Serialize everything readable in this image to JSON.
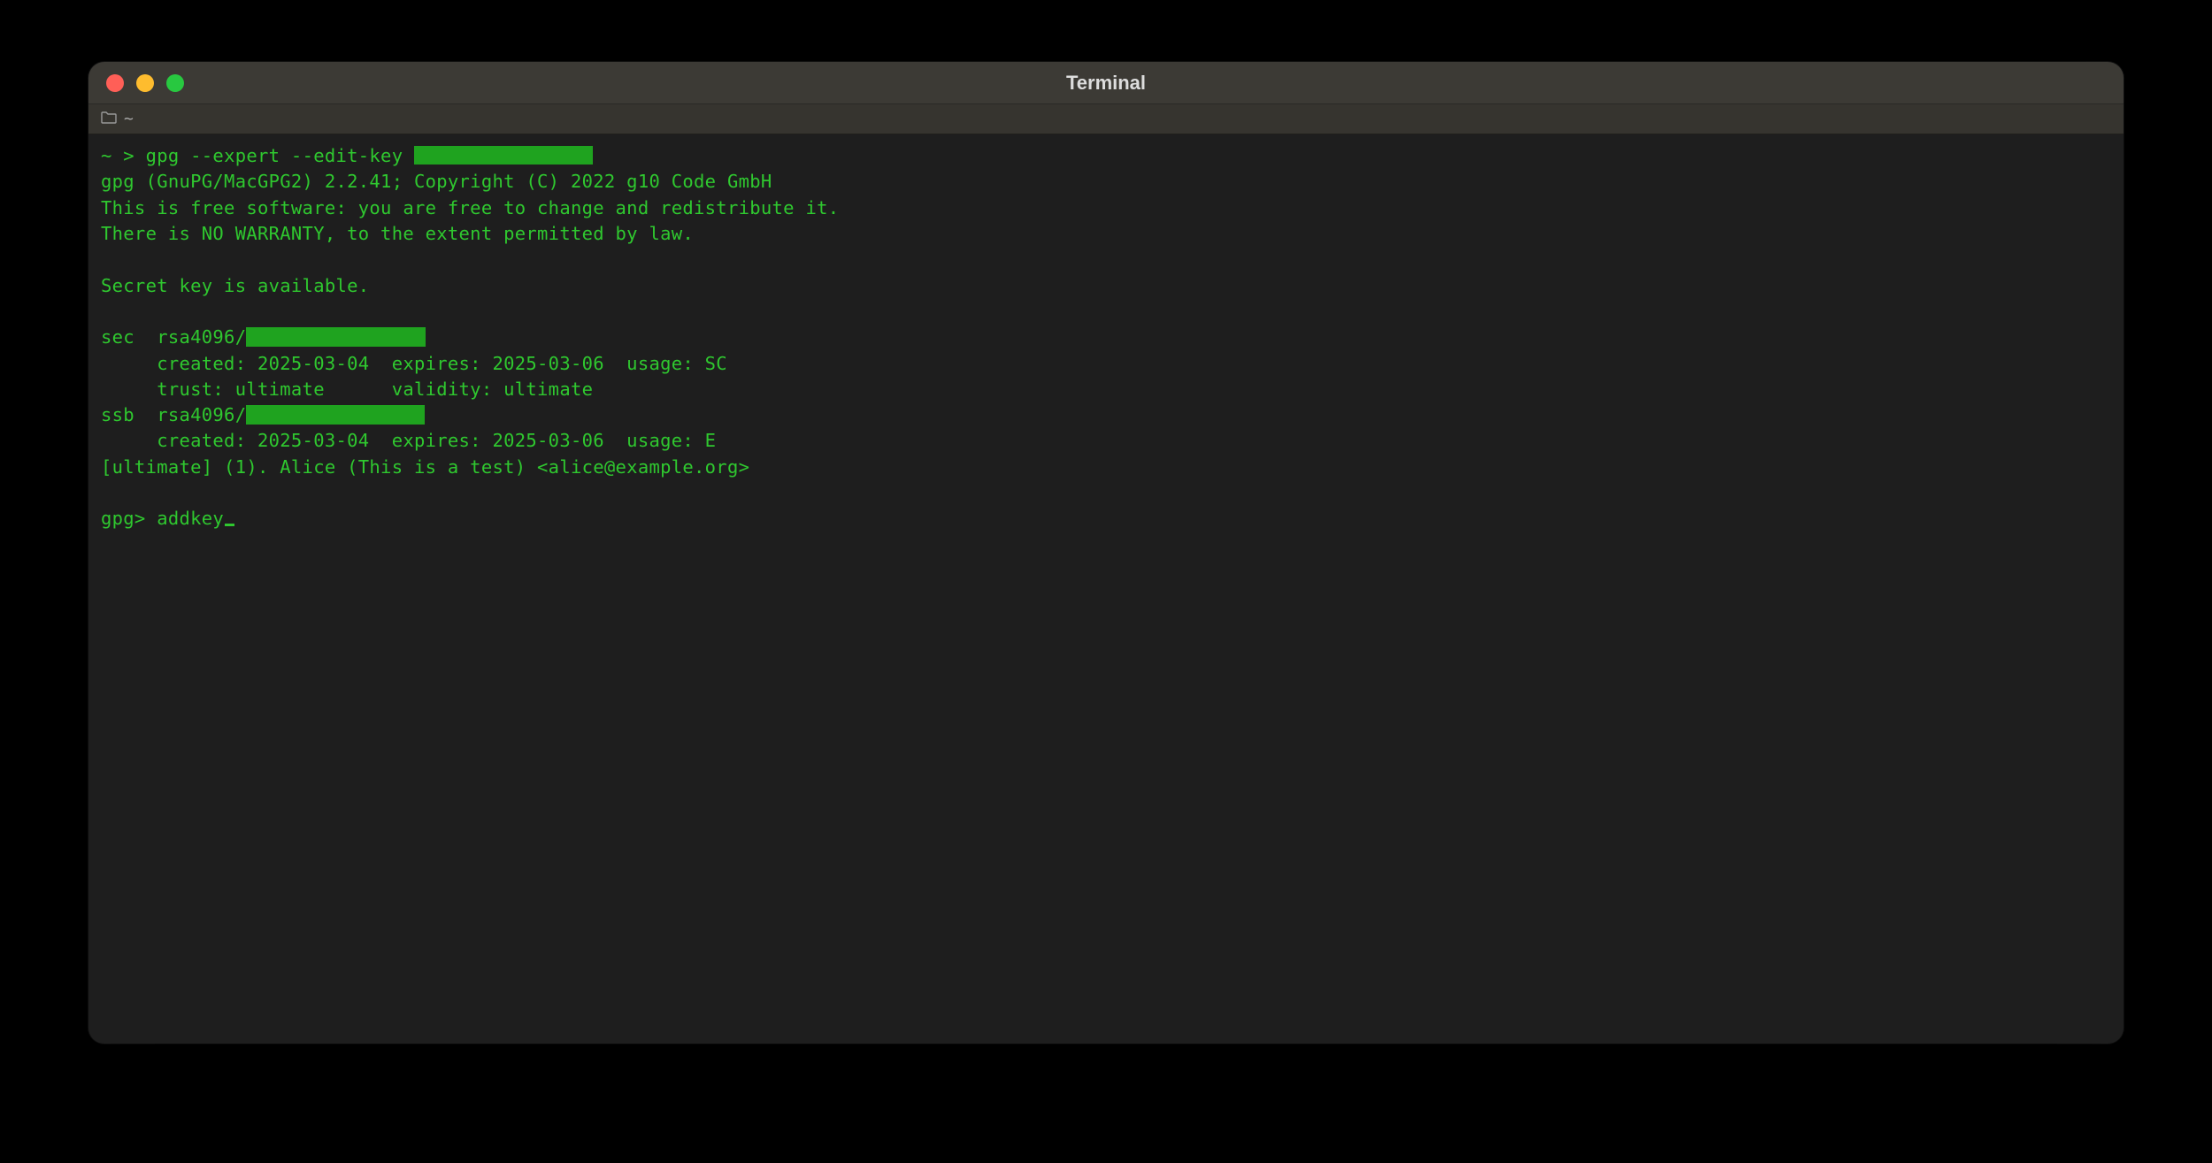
{
  "window": {
    "title": "Terminal",
    "tab_label": "~"
  },
  "session": {
    "prompt": "~ > ",
    "command": "gpg --expert --edit-key ",
    "output": {
      "banner1": "gpg (GnuPG/MacGPG2) 2.2.41; Copyright (C) 2022 g10 Code GmbH",
      "banner2": "This is free software: you are free to change and redistribute it.",
      "banner3": "There is NO WARRANTY, to the extent permitted by law.",
      "secret": "Secret key is available.",
      "sec_prefix": "sec  rsa4096/",
      "sec_details": "     created: 2025-03-04  expires: 2025-03-06  usage: SC",
      "sec_trust": "     trust: ultimate      validity: ultimate",
      "ssb_prefix": "ssb  rsa4096/",
      "ssb_details": "     created: 2025-03-04  expires: 2025-03-06  usage: E",
      "uid": "[ultimate] (1). Alice (This is a test) <alice@example.org>",
      "gpg_prompt": "gpg> ",
      "gpg_input": "addkey"
    }
  }
}
